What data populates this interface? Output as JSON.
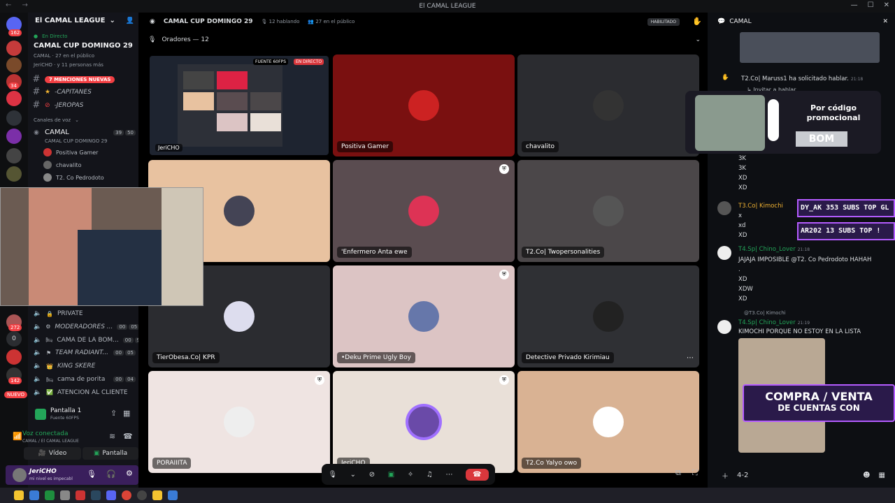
{
  "window": {
    "title": "El CAMAL LEAGUE"
  },
  "rail": {
    "badges": [
      "162",
      "34",
      "272",
      "0",
      "142",
      "NUEVO"
    ]
  },
  "sidebar": {
    "server_name": "El CAMAL LEAGUE",
    "live_label": "En Directo",
    "event_title": "CAMAL CUP DOMINGO 29",
    "event_info": "CAMAL · 27 en el público",
    "event_people": "JeriCHO · y 11 personas más",
    "mentions_badge": "7 MENCIONES NUEVAS",
    "text_channels": [
      "-CAPITANES",
      "-JEROPAS"
    ],
    "voice_category": "Canales de voz",
    "voice_channel": {
      "name": "CAMAL",
      "sub": "CAMAL CUP DOMINGO 29",
      "c1": "39",
      "c2": "50"
    },
    "members": [
      "Positiva Gamer",
      "chavalito",
      "T2. Co Pedrodoto"
    ],
    "lower_channels": [
      {
        "name": "PRIVATE",
        "c1": "",
        "c2": ""
      },
      {
        "name": "MODERADORES ...",
        "c1": "00",
        "c2": "05"
      },
      {
        "name": "CAMA DE LA BOM...",
        "c1": "00",
        "c2": "99"
      },
      {
        "name": "TEAM RADIANT...",
        "c1": "00",
        "c2": "05"
      },
      {
        "name": "KING SKERE",
        "c1": "",
        "c2": ""
      },
      {
        "name": "cama de porita",
        "c1": "00",
        "c2": "04"
      },
      {
        "name": "ATENCION AL CLIENTE",
        "c1": "",
        "c2": ""
      }
    ],
    "screen": {
      "title": "Pantalla 1",
      "sub": "Fuente 60FPS"
    },
    "voice_connected": {
      "title": "Voz conectada",
      "sub": "CAMAL / El CAMAL LEAGUE"
    },
    "video_label": "Vídeo",
    "screen_label": "Pantalla",
    "user": {
      "name": "JeriCHO",
      "status": "mi nivel es impecabl"
    }
  },
  "main": {
    "header": {
      "title": "CAMAL CUP DOMINGO 29",
      "speaking": "12 hablando",
      "audience": "27 en el público",
      "status": "HABILITADO"
    },
    "speakers_label": "Oradores — 12",
    "stream_badges": [
      "FUENTE 60FPS",
      "EN DIRECTO"
    ],
    "stream_owner": "JeriCHO",
    "tiles": [
      {
        "name": "",
        "bg": "#2a2d33"
      },
      {
        "name": "Positiva Gamer",
        "bg": "#7a1010"
      },
      {
        "name": "chavalito",
        "bg": "#2b2c30"
      },
      {
        "name": "",
        "bg": "#e8c2a0"
      },
      {
        "name": "'Enfermero Anta ewe",
        "bg": "#5a4c50"
      },
      {
        "name": "T2.Co| Twopersonalities",
        "bg": "#4b4749"
      },
      {
        "name": "TierObesa.Co| KPR",
        "bg": "#2b2c30"
      },
      {
        "name": "•Deku Prime Ugly Boy",
        "bg": "#dcc4c4"
      },
      {
        "name": "Detective Privado Kirimiau",
        "bg": "#2f3034"
      },
      {
        "name": "PORAIIITA",
        "bg": "#efe4e2"
      },
      {
        "name": "JeriCHO",
        "bg": "#e9e0d8"
      },
      {
        "name": "T2.Co Yalyo owo",
        "bg": "#d9b293"
      }
    ]
  },
  "chat": {
    "title": "CAMAL",
    "request": "T2.Co| Maruss1 ha solicitado hablar.",
    "request_time": "21:18",
    "invite": "Invitar a hablar",
    "spam_lines": [
      "3K",
      "3K",
      "XD",
      "XD"
    ],
    "messages": [
      {
        "user": "T3.Co| Kimochi",
        "time": "",
        "lines": [
          "x",
          "xd",
          "XD"
        ]
      },
      {
        "user": "T4.Sp| Chino_Lover",
        "time": "21:18",
        "lines": [
          "JAJAJA IMPOSIBLE @T2. Co Pedrodoto HAHAH",
          ".",
          "XD",
          "XDW",
          "XD"
        ]
      },
      {
        "user": "T4.Sp| Chino_Lover",
        "time": "21:19",
        "reply": "@T3.Co| Kimochi",
        "lines": [
          "KIMOCHI PORQUE NO ESTOY EN LA LISTA"
        ]
      }
    ],
    "input_text": "4-2",
    "promo": {
      "title": "Por código promocional",
      "code": "BOM"
    },
    "neon_top": [
      "DY_AK 353 SUBS  TOP GL",
      "AR202 13 SUBS    TOP !"
    ],
    "neon_bottom": [
      "COMPRA / VENTA",
      "DE CUENTAS CON"
    ]
  },
  "colors": {
    "accent": "#5865f2",
    "green": "#23a559",
    "red": "#da373c",
    "neon": "#b45cff"
  }
}
